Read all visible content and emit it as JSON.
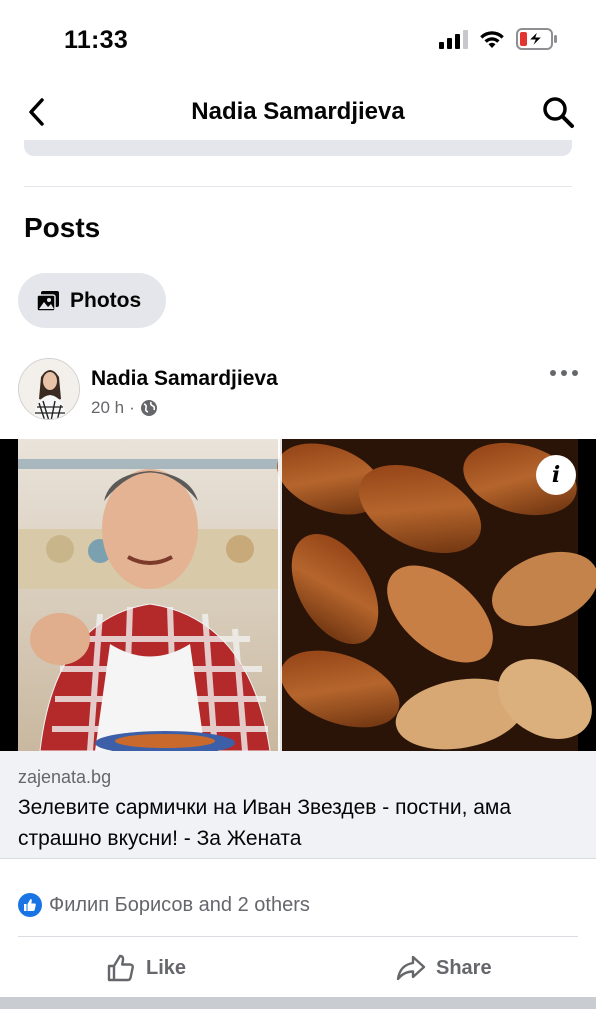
{
  "status_bar": {
    "time": "11:33",
    "icons": [
      "cellular-signal-icon",
      "wifi-icon",
      "battery-low-charging-icon"
    ]
  },
  "header": {
    "title": "Nadia Samardjieva",
    "back_icon": "chevron-left-icon",
    "search_icon": "search-icon"
  },
  "posts_section": {
    "title": "Posts",
    "filter_chip": {
      "label": "Photos",
      "icon": "photo-icon"
    }
  },
  "post": {
    "author": "Nadia Samardjieva",
    "time": "20 h",
    "separator": "·",
    "audience_icon": "globe-icon",
    "more_icon": "more-horizontal-icon",
    "info_icon_glyph": "i",
    "link": {
      "domain": "zajenata.bg",
      "title": "Зелевите сармички на Иван Звездев - постни, ама страшно вкусни! - За Жената"
    },
    "reactions": {
      "text": "Филип Борисов and 2 others",
      "icon": "like-reaction-icon"
    },
    "actions": {
      "like_label": "Like",
      "share_label": "Share"
    }
  },
  "colors": {
    "accent": "#1b74e4",
    "secondary_text": "#65676b",
    "chip_bg": "#e4e6eb",
    "preview_bg": "#f0f2f5",
    "battery_low": "#e3342f"
  }
}
